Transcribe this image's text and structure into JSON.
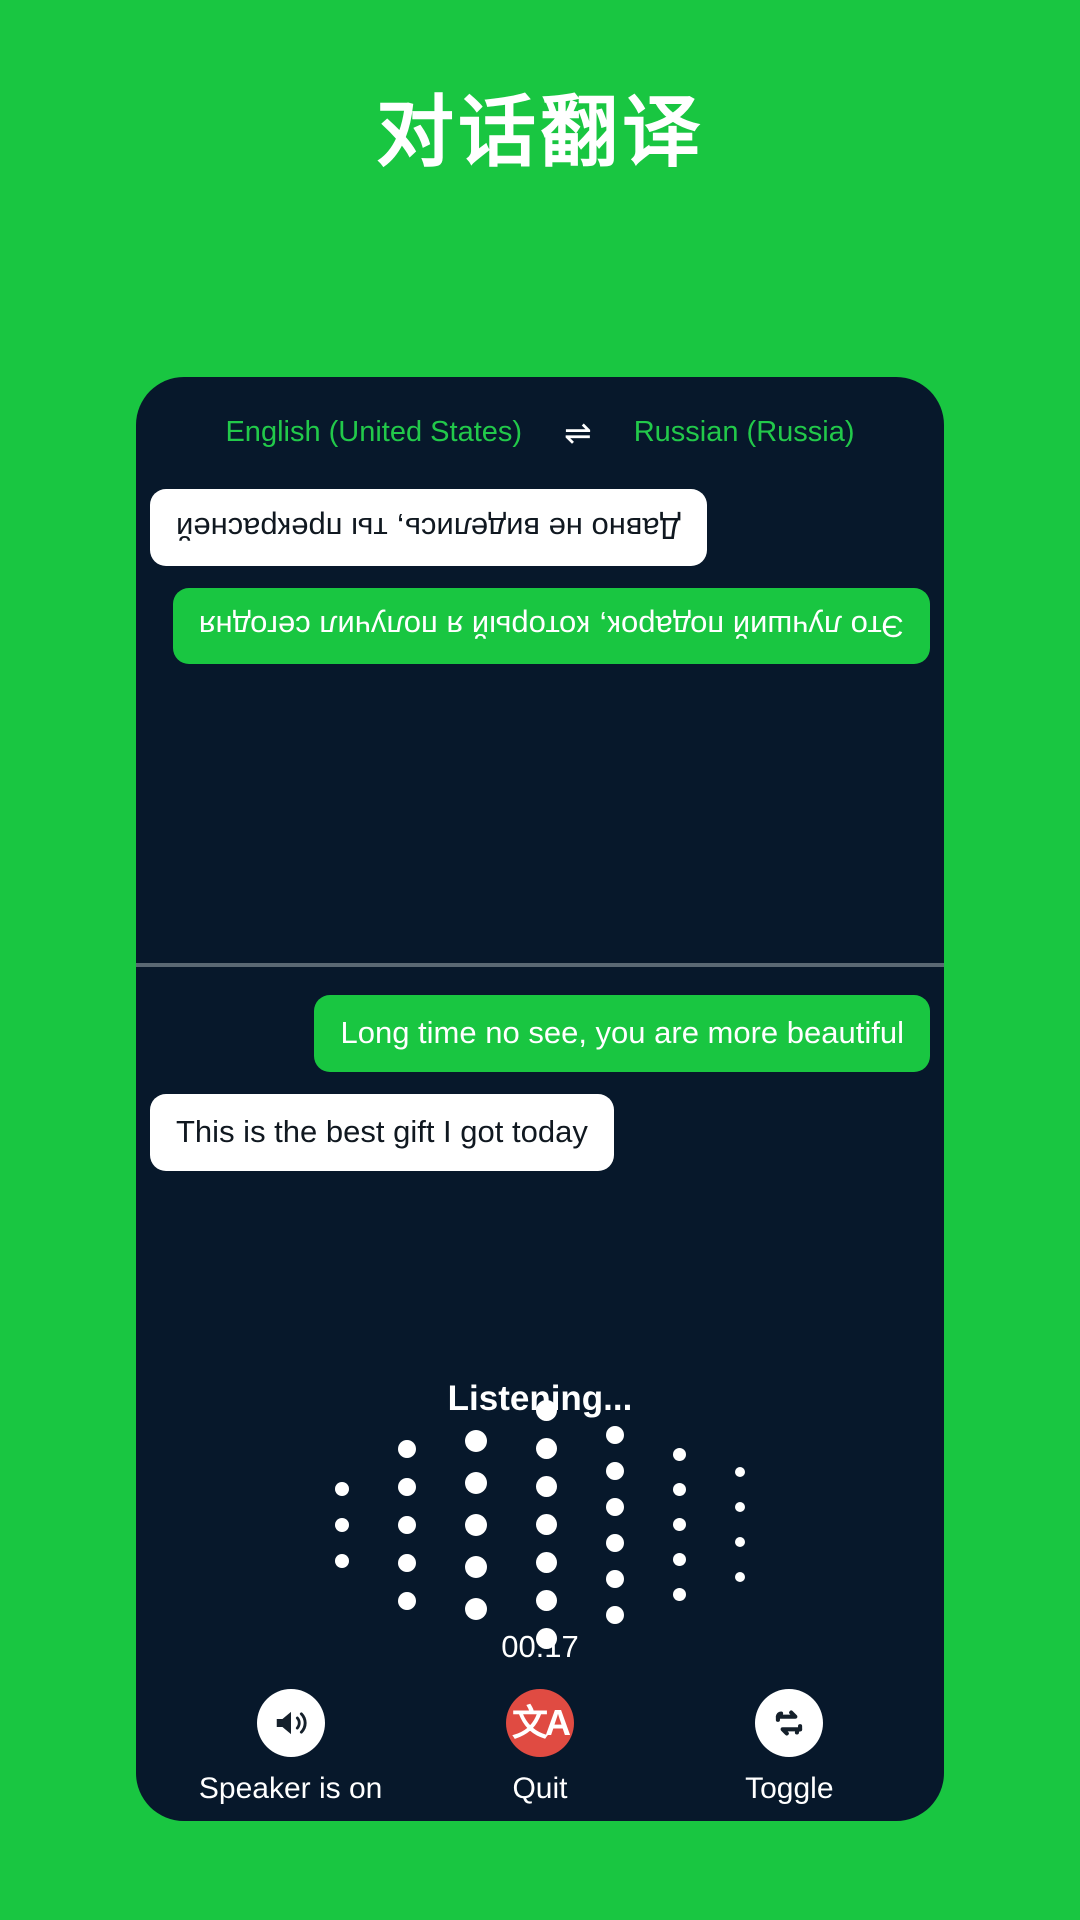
{
  "page": {
    "title": "对话翻译",
    "background_color": "#19C641",
    "card_color": "#07182B"
  },
  "language_bar": {
    "source_language": "English (United States)",
    "swap_icon": "swap-horizontal-icon",
    "swap_glyph": "⇌",
    "target_language": "Russian (Russia)",
    "text_color": "#22C94A"
  },
  "conversation": {
    "remote_pane": {
      "rotated": true,
      "messages": [
        {
          "text": "Это лучший подарок, который я получил сегодня",
          "style": "green",
          "align": "align-left"
        },
        {
          "text": "Давно не виделись, ты прекрасней",
          "style": "white",
          "align": "align-right"
        }
      ]
    },
    "local_pane": {
      "messages": [
        {
          "text": "Long time no see, you are more beautiful",
          "style": "green",
          "align": "align-right"
        },
        {
          "text": "This is the best gift I got today",
          "style": "white",
          "align": "align-left"
        }
      ]
    }
  },
  "status": {
    "listening_label": "Listening...",
    "timer": "00:17"
  },
  "waveform": {
    "icon": "audio-waveform-dots",
    "columns": [
      {
        "count": 3,
        "dot_size": 14,
        "gap": 22
      },
      {
        "count": 5,
        "dot_size": 18,
        "gap": 20
      },
      {
        "count": 5,
        "dot_size": 22,
        "gap": 20
      },
      {
        "count": 7,
        "dot_size": 21,
        "gap": 17
      },
      {
        "count": 6,
        "dot_size": 18,
        "gap": 18
      },
      {
        "count": 5,
        "dot_size": 13,
        "gap": 22
      },
      {
        "count": 4,
        "dot_size": 10,
        "gap": 25
      }
    ]
  },
  "controls": [
    {
      "label": "Speaker is on",
      "icon": "speaker-on-icon",
      "circle_style": "light",
      "accent": "#ffffff"
    },
    {
      "label": "Quit",
      "icon": "translate-icon",
      "circle_style": "danger",
      "accent": "#E04B42",
      "glyph": "文A"
    },
    {
      "label": "Toggle",
      "icon": "repeat-swap-icon",
      "circle_style": "light",
      "accent": "#ffffff"
    }
  ]
}
